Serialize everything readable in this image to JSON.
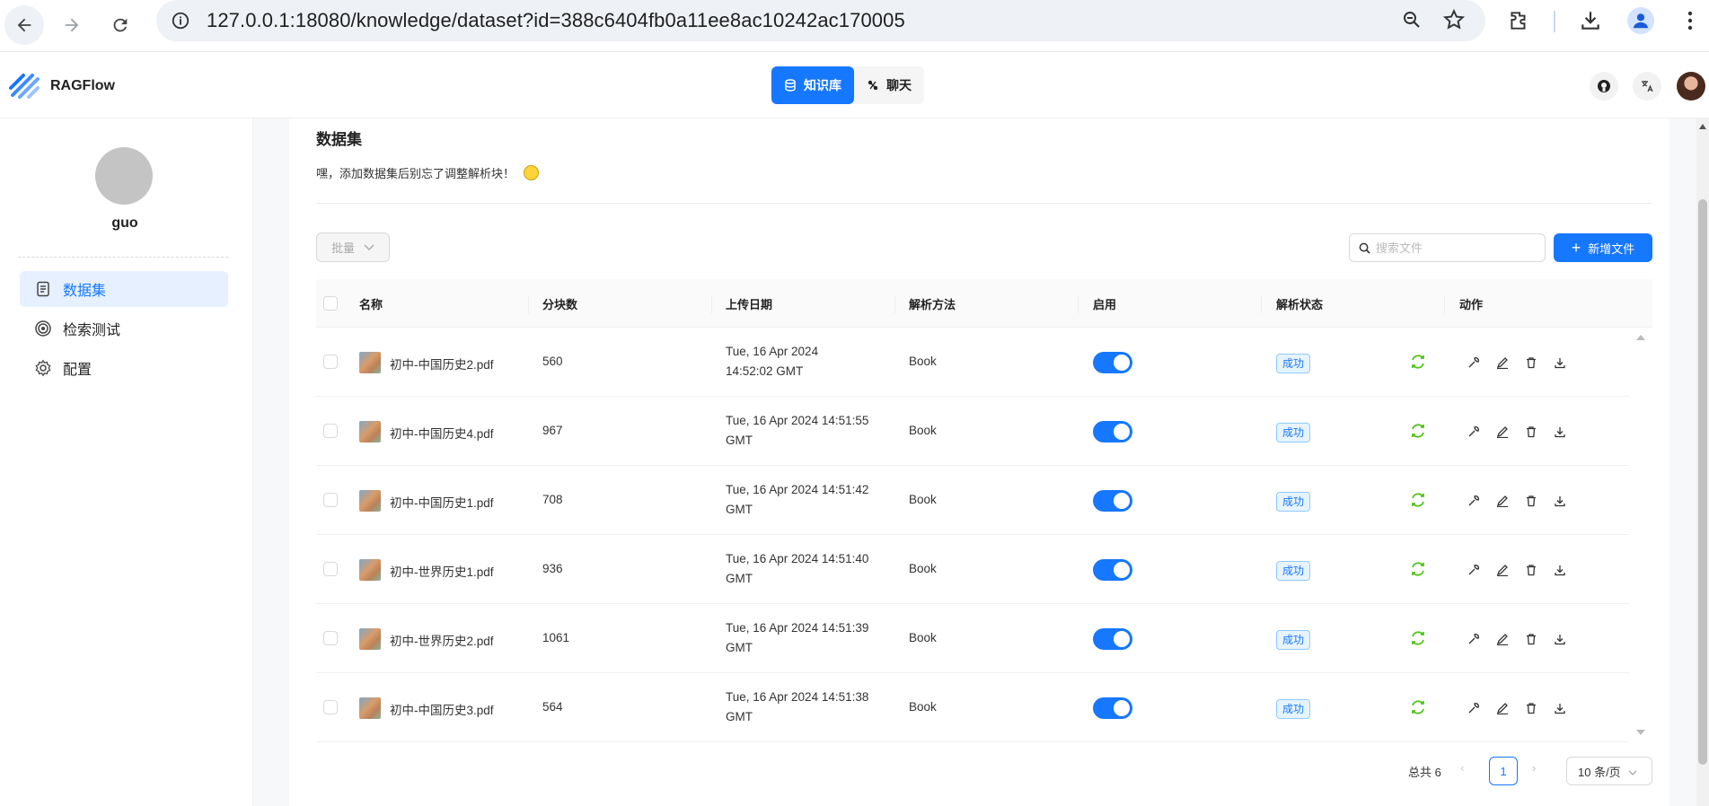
{
  "browser": {
    "url": "127.0.0.1:18080/knowledge/dataset?id=388c6404fb0a11ee8ac10242ac170005"
  },
  "header": {
    "app_name": "RAGFlow",
    "tabs": [
      {
        "label": "知识库",
        "active": true
      },
      {
        "label": "聊天",
        "active": false
      }
    ]
  },
  "sidebar": {
    "user_name": "guo",
    "items": [
      {
        "label": "数据集",
        "active": true
      },
      {
        "label": "检索测试",
        "active": false
      },
      {
        "label": "配置",
        "active": false
      }
    ]
  },
  "main": {
    "title": "数据集",
    "tip": "嘿，添加数据集后别忘了调整解析块！",
    "bulk_label": "批量",
    "search_placeholder": "搜索文件",
    "add_label": "新增文件",
    "columns": [
      "名称",
      "分块数",
      "上传日期",
      "解析方法",
      "启用",
      "解析状态",
      "动作"
    ],
    "rows": [
      {
        "name": "初中-中国历史2.pdf",
        "chunks": "560",
        "date_line1": "Tue, 16 Apr 2024",
        "date_line2": "14:52:02 GMT",
        "method": "Book",
        "enabled": true,
        "status": "成功"
      },
      {
        "name": "初中-中国历史4.pdf",
        "chunks": "967",
        "date_line1": "Tue, 16 Apr 2024 14:51:55",
        "date_line2": "GMT",
        "method": "Book",
        "enabled": true,
        "status": "成功"
      },
      {
        "name": "初中-中国历史1.pdf",
        "chunks": "708",
        "date_line1": "Tue, 16 Apr 2024 14:51:42",
        "date_line2": "GMT",
        "method": "Book",
        "enabled": true,
        "status": "成功"
      },
      {
        "name": "初中-世界历史1.pdf",
        "chunks": "936",
        "date_line1": "Tue, 16 Apr 2024 14:51:40",
        "date_line2": "GMT",
        "method": "Book",
        "enabled": true,
        "status": "成功"
      },
      {
        "name": "初中-世界历史2.pdf",
        "chunks": "1061",
        "date_line1": "Tue, 16 Apr 2024 14:51:39",
        "date_line2": "GMT",
        "method": "Book",
        "enabled": true,
        "status": "成功"
      },
      {
        "name": "初中-中国历史3.pdf",
        "chunks": "564",
        "date_line1": "Tue, 16 Apr 2024 14:51:38",
        "date_line2": "GMT",
        "method": "Book",
        "enabled": true,
        "status": "成功"
      }
    ],
    "pagination": {
      "total_label": "总共 6",
      "current_page": "1",
      "page_size_label": "10 条/页"
    }
  },
  "colors": {
    "primary": "#1677ff",
    "success": "#52c41a",
    "active_bg": "#e6f0ff"
  }
}
